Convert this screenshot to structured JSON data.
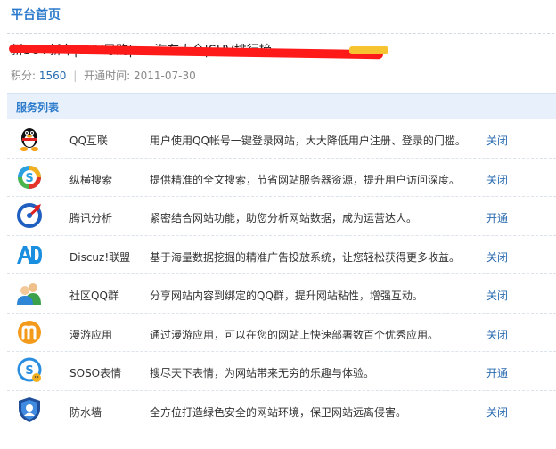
{
  "page": {
    "title": "平台首页"
  },
  "site": {
    "name": "新SUV新车|SUV导购|suv汽车大全|SUV排行榜",
    "points_label": "积分:",
    "points_value": "1560",
    "opened_label": "开通时间:",
    "opened_value": "2011-07-30"
  },
  "services": {
    "header": "服务列表",
    "items": [
      {
        "icon": "qq-penguin-icon",
        "name": "QQ互联",
        "desc": "用户使用QQ帐号一键登录网站，大大降低用户注册、登录的门槛。",
        "action": "关闭"
      },
      {
        "icon": "soso-search-icon",
        "name": "纵横搜索",
        "desc": "提供精准的全文搜索，节省网站服务器资源，提升用户访问深度。",
        "action": "关闭"
      },
      {
        "icon": "analytics-gauge-icon",
        "name": "腾讯分析",
        "desc": "紧密结合网站功能，助您分析网站数据，成为运营达人。",
        "action": "开通"
      },
      {
        "icon": "ad-union-icon",
        "name": "Discuz!联盟",
        "desc": "基于海量数据挖掘的精准广告投放系统，让您轻松获得更多收益。",
        "action": "关闭"
      },
      {
        "icon": "qq-group-icon",
        "name": "社区QQ群",
        "desc": "分享网站内容到绑定的QQ群，提升网站粘性，增强互动。",
        "action": "关闭"
      },
      {
        "icon": "manyou-app-icon",
        "name": "漫游应用",
        "desc": "通过漫游应用，可以在您的网站上快速部署数百个优秀应用。",
        "action": "关闭"
      },
      {
        "icon": "soso-emoticon-icon",
        "name": "SOSO表情",
        "desc": "搜尽天下表情，为网站带来无穷的乐趣与体验。",
        "action": "开通"
      },
      {
        "icon": "firewall-shield-icon",
        "name": "防水墙",
        "desc": "全方位打造绿色安全的网站环境，保卫网站远离侵害。",
        "action": "关闭"
      }
    ]
  }
}
